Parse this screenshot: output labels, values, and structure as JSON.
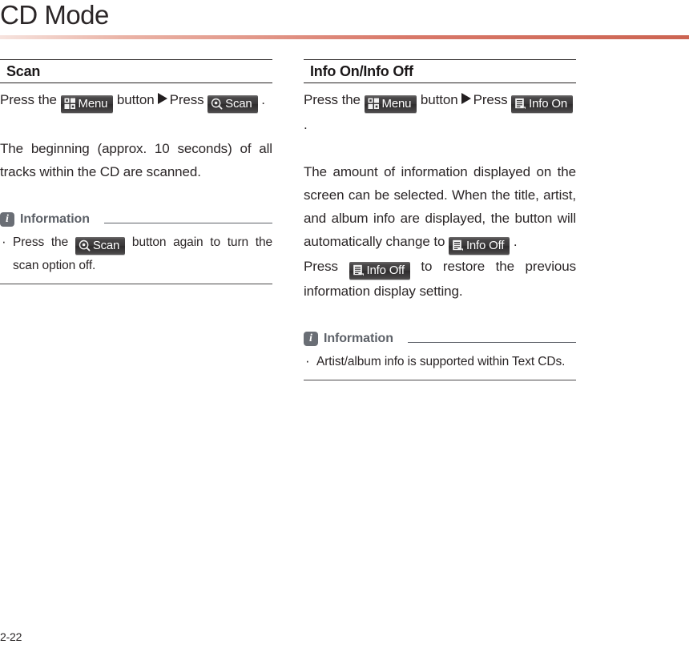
{
  "page": {
    "title": "CD Mode",
    "number": "2-22",
    "accent_color": "#cc6452",
    "rule_color": "#231f20",
    "info_color": "#5d6168",
    "key_color": "#3a3839"
  },
  "left_column": {
    "heading": "Scan",
    "steps": {
      "lead": "Press the",
      "menu_key": {
        "label": "Menu",
        "icon": "grid-icon"
      },
      "middle": "button",
      "arrow": "play-triangle-icon",
      "press": "Press",
      "scan_key": {
        "label": "Scan",
        "icon": "magnifier-icon"
      },
      "period": "."
    },
    "description": "The beginning (approx. 10 seconds) of all tracks within the CD are scanned.",
    "information": {
      "badge": "i",
      "title": "Information",
      "items": [
        {
          "before": "Press the",
          "key": {
            "label": "Scan",
            "icon": "magnifier-icon"
          },
          "after": "button again to turn the scan option off."
        }
      ]
    }
  },
  "right_column": {
    "heading": "Info On/Info Off",
    "steps": {
      "lead": "Press the",
      "menu_key": {
        "label": "Menu",
        "icon": "grid-icon"
      },
      "middle": "button",
      "arrow": "play-triangle-icon",
      "press": "Press",
      "info_on_key": {
        "label": "Info On",
        "icon": "document-lines-icon"
      },
      "period": "."
    },
    "description_part1": "The amount of information displayed on the screen can be selected. When the title, artist, and album info are displayed, the button will automatically change to",
    "info_off_key": {
      "label": "Info Off",
      "icon": "document-lines-icon"
    },
    "period": ".",
    "description_part2_before": "Press",
    "description_part2_key": {
      "label": "Info Off",
      "icon": "document-lines-icon"
    },
    "description_part2_after": "to restore the previous information display setting.",
    "information": {
      "badge": "i",
      "title": "Information",
      "items": [
        {
          "before": "",
          "key": null,
          "after": "Artist/album info is supported within Text CDs."
        }
      ]
    }
  }
}
